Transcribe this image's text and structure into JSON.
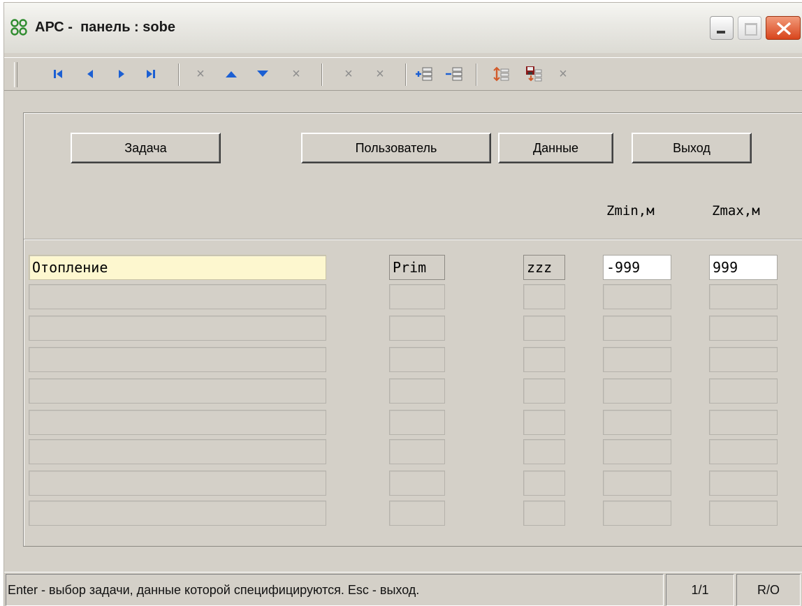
{
  "window": {
    "title_app": "АРС -",
    "title_panel": "панель : sobe",
    "controls": {
      "minimize_icon": "minimize-icon",
      "maximize_icon": "maximize-icon",
      "close_icon": "close-icon"
    }
  },
  "toolbar": {
    "icons": [
      "first-record-icon",
      "prev-record-icon",
      "next-record-icon",
      "last-record-icon",
      "delete-icon",
      "move-up-icon",
      "move-down-icon",
      "delete-icon",
      "delete-icon",
      "delete-icon",
      "add-row-icon",
      "remove-row-icon",
      "swap-icon",
      "save-icon",
      "delete-icon"
    ],
    "disabled_glyph": "×"
  },
  "buttons": {
    "task": "Задача",
    "user": "Пользователь",
    "data": "Данные",
    "exit": "Выход"
  },
  "columns": {
    "zmin": "Zmin,м",
    "zmax": "Zmax,м"
  },
  "rows": [
    {
      "name": "Отопление",
      "prim": "Prim",
      "code": "zzz",
      "zmin": "-999",
      "zmax": "999"
    },
    {
      "name": "",
      "prim": "",
      "code": "",
      "zmin": "",
      "zmax": ""
    },
    {
      "name": "",
      "prim": "",
      "code": "",
      "zmin": "",
      "zmax": ""
    },
    {
      "name": "",
      "prim": "",
      "code": "",
      "zmin": "",
      "zmax": ""
    },
    {
      "name": "",
      "prim": "",
      "code": "",
      "zmin": "",
      "zmax": ""
    },
    {
      "name": "",
      "prim": "",
      "code": "",
      "zmin": "",
      "zmax": ""
    },
    {
      "name": "",
      "prim": "",
      "code": "",
      "zmin": "",
      "zmax": ""
    },
    {
      "name": "",
      "prim": "",
      "code": "",
      "zmin": "",
      "zmax": ""
    },
    {
      "name": "",
      "prim": "",
      "code": "",
      "zmin": "",
      "zmax": ""
    }
  ],
  "status": {
    "message": "Enter - выбор задачи, данные которой специфицируются. Esc - выход.",
    "record": "1/1",
    "mode": "R/O"
  },
  "colors": {
    "face": "#d4d0c8",
    "active_field": "#fdf7cf",
    "nav_icon": "#1b5fd3",
    "close": "#d8451c"
  }
}
